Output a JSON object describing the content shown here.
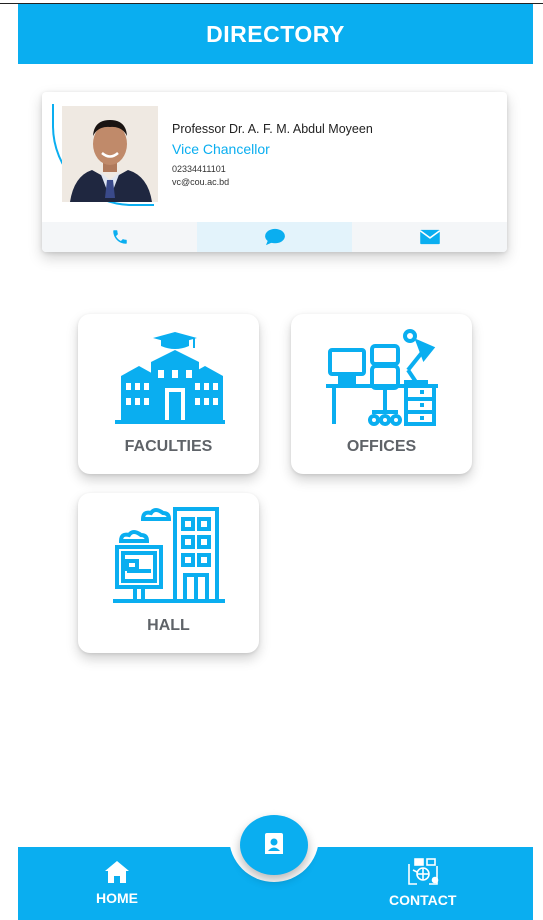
{
  "header": {
    "title": "DIRECTORY"
  },
  "profile": {
    "name": "Professor Dr. A. F. M. Abdul Moyeen",
    "position": "Vice Chancellor",
    "phone": "02334411101",
    "email": "vc@cou.ac.bd",
    "actions": [
      "phone-icon",
      "chat-icon",
      "mail-icon"
    ]
  },
  "tiles": [
    {
      "label": "FACULTIES",
      "icon": "university-building-icon"
    },
    {
      "label": "OFFICES",
      "icon": "office-desk-icon"
    },
    {
      "label": "HALL",
      "icon": "residence-hall-icon"
    }
  ],
  "bottom_nav": {
    "home_label": "HOME",
    "contact_label": "CONTACT",
    "center_icon": "contact-book-icon"
  },
  "colors": {
    "accent": "#0aaef0",
    "label_gray": "#5f6368"
  }
}
